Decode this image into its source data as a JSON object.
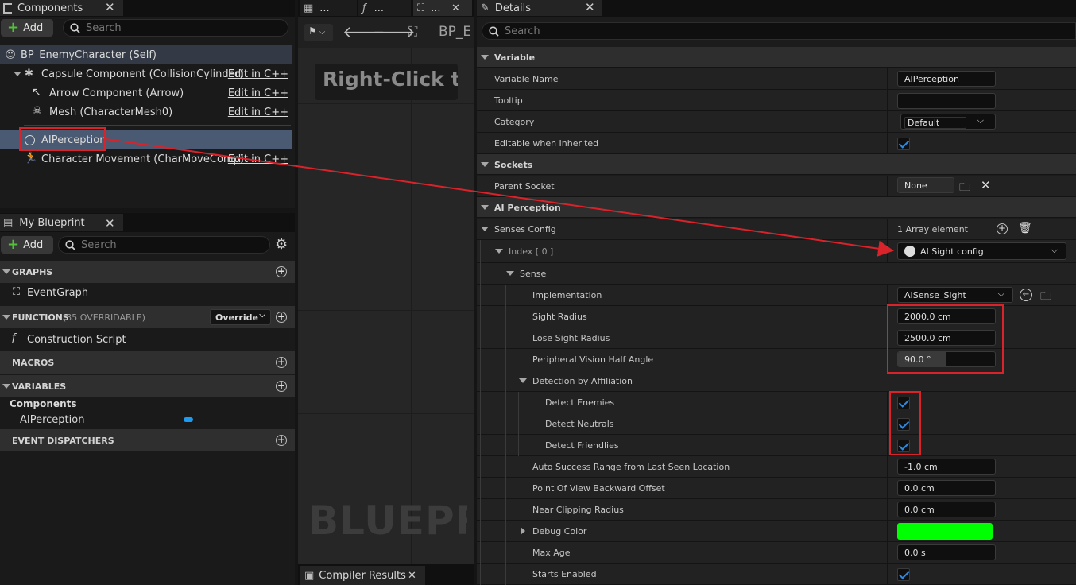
{
  "components_panel": {
    "tab_label": "Components",
    "add_label": "Add",
    "search_placeholder": "Search",
    "self_label": "BP_EnemyCharacter (Self)",
    "items": [
      {
        "label": "Capsule Component (CollisionCylinder)",
        "edit": "Edit in C++"
      },
      {
        "label": "Arrow Component (Arrow)",
        "edit": "Edit in C++"
      },
      {
        "label": "Mesh (CharacterMesh0)",
        "edit": "Edit in C++"
      },
      {
        "label": "AIPerception",
        "edit": ""
      },
      {
        "label": "Character Movement (CharMoveComp)",
        "edit": "Edit in C++"
      }
    ]
  },
  "my_blueprint": {
    "tab_label": "My Blueprint",
    "add_label": "Add",
    "search_placeholder": "Search",
    "graphs_label": "GRAPHS",
    "event_graph": "EventGraph",
    "functions_label": "FUNCTIONS",
    "functions_count": "(35 OVERRIDABLE)",
    "override_label": "Override",
    "construction_script": "Construction Script",
    "macros_label": "MACROS",
    "variables_label": "VARIABLES",
    "components_group": "Components",
    "var_aiperception": "AIPerception",
    "event_dispatchers_label": "EVENT DISPATCHERS"
  },
  "graph_panel": {
    "tab1": "...",
    "tab2": "...",
    "tab3": "...",
    "breadcrumb": "BP_E",
    "hint_text": "Right-Click t",
    "watermark": "BLUEPR",
    "compiler_tab": "Compiler Results"
  },
  "details": {
    "tab_label": "Details",
    "search_placeholder": "Search",
    "variable_section": "Variable",
    "variable_name_label": "Variable Name",
    "variable_name_value": "AIPerception",
    "tooltip_label": "Tooltip",
    "tooltip_value": "",
    "category_label": "Category",
    "category_value": "Default",
    "editable_label": "Editable when Inherited",
    "sockets_section": "Sockets",
    "parent_socket_label": "Parent Socket",
    "parent_socket_value": "None",
    "ai_perception_section": "AI Perception",
    "senses_config_label": "Senses Config",
    "senses_config_value": "1 Array element",
    "index_label": "Index [ 0 ]",
    "index_value": "AI Sight config",
    "sense_label": "Sense",
    "implementation_label": "Implementation",
    "implementation_value": "AISense_Sight",
    "sight_radius_label": "Sight Radius",
    "sight_radius_value": "2000.0 cm",
    "lose_sight_label": "Lose Sight Radius",
    "lose_sight_value": "2500.0 cm",
    "peripheral_label": "Peripheral Vision Half Angle",
    "peripheral_value": "90.0 °",
    "peripheral_fill": 0.5,
    "detection_label": "Detection by Affiliation",
    "detect_enemies_label": "Detect Enemies",
    "detect_neutrals_label": "Detect Neutrals",
    "detect_friendlies_label": "Detect Friendlies",
    "auto_success_label": "Auto Success Range from Last Seen Location",
    "auto_success_value": "-1.0 cm",
    "pov_label": "Point Of View Backward Offset",
    "pov_value": "0.0 cm",
    "near_clip_label": "Near Clipping Radius",
    "near_clip_value": "0.0 cm",
    "debug_color_label": "Debug Color",
    "debug_color": "#00ff00",
    "max_age_label": "Max Age",
    "max_age_value": "0.0 s",
    "starts_enabled_label": "Starts Enabled"
  },
  "colors": {
    "accent_blue": "#2d8ae0",
    "annotation_red": "#d8232a",
    "add_green": "#52c038",
    "variable_pill": "#1e9af0"
  }
}
